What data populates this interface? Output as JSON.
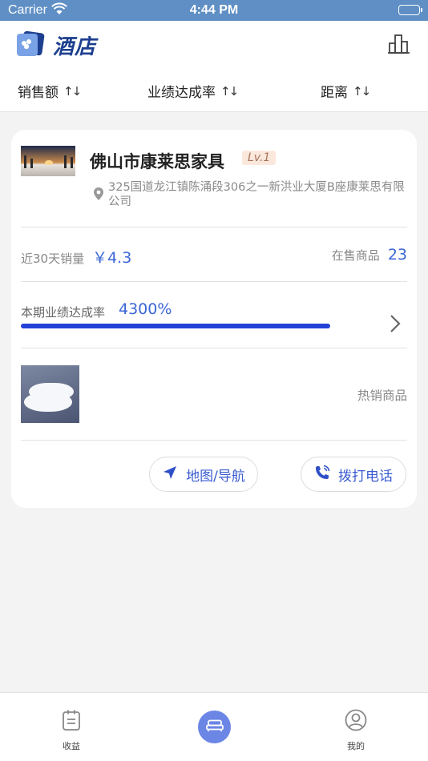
{
  "status_bar": {
    "carrier": "Carrier",
    "time": "4:44 PM"
  },
  "header": {
    "title": "酒店"
  },
  "sort_bar": {
    "items": [
      {
        "label": "销售额"
      },
      {
        "label": "业绩达成率"
      },
      {
        "label": "距离"
      }
    ]
  },
  "store_card": {
    "name": "佛山市康莱思家具",
    "level": "Lv.1",
    "address": "325国道龙江镇陈涌段306之一新洪业大厦B座康莱思有限公司",
    "sales_label": "近30天销量",
    "sales_value": "￥4.3",
    "stock_label": "在售商品",
    "stock_value": "23",
    "rate_label": "本期业绩达成率",
    "rate_value": "4300%",
    "rate_progress": 1.0,
    "hot_label": "热销商品",
    "map_button": "地图/导航",
    "call_button": "拨打电话"
  },
  "tab_bar": {
    "items": [
      {
        "label": "收益"
      },
      {
        "label": ""
      },
      {
        "label": "我的"
      }
    ]
  },
  "colors": {
    "accent": "#3b66d6",
    "progress": "#2441d8",
    "status_bar": "#5f8fc4",
    "center_tab": "#6c86e6"
  }
}
